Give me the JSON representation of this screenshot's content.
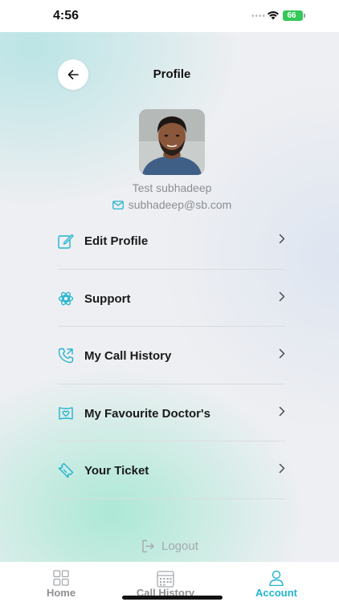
{
  "status_bar": {
    "time": "4:56",
    "battery": "66"
  },
  "header": {
    "title": "Profile",
    "back_icon": "arrow-left-icon"
  },
  "profile": {
    "name": "Test subhadeep",
    "email": "subhadeep@sb.com"
  },
  "menu": {
    "items": [
      {
        "label": "Edit Profile",
        "icon": "edit-icon"
      },
      {
        "label": "Support",
        "icon": "support-icon"
      },
      {
        "label": "My Call History",
        "icon": "phone-call-icon"
      },
      {
        "label": "My Favourite Doctor's",
        "icon": "favourite-icon"
      },
      {
        "label": "Your Ticket",
        "icon": "ticket-icon"
      }
    ]
  },
  "logout": {
    "label": "Logout"
  },
  "tab_bar": {
    "tabs": [
      {
        "label": "Home",
        "icon": "grid-icon",
        "active": false
      },
      {
        "label": "Call History",
        "icon": "calendar-icon",
        "active": false
      },
      {
        "label": "Account",
        "icon": "user-icon",
        "active": true
      }
    ]
  },
  "colors": {
    "accent": "#23b4cf",
    "text_primary": "#1a1a1a",
    "text_muted": "#8b8f94",
    "divider": "#d9dcde",
    "battery": "#35c759"
  }
}
